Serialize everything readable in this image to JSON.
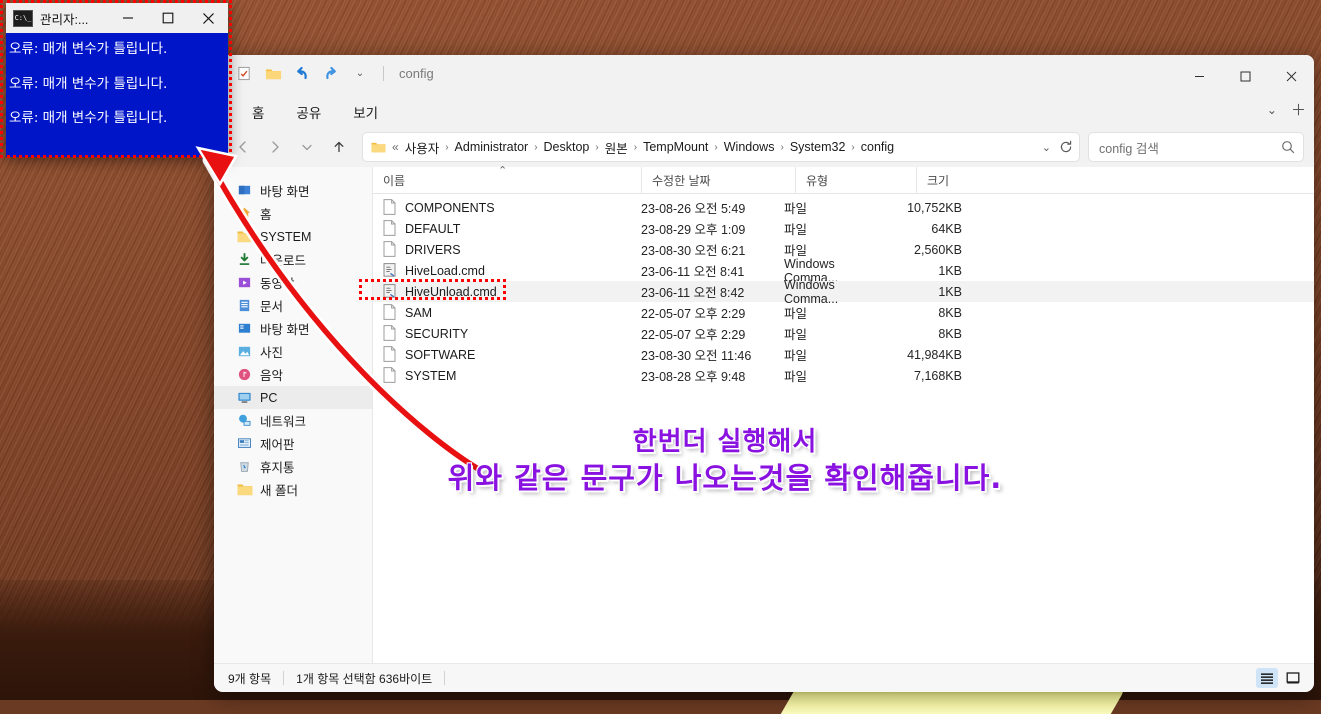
{
  "console_window": {
    "title": "관리자:...",
    "icon": "console-icon",
    "minimize": "—",
    "maximize": "□",
    "close": "✕",
    "lines": [
      "오류: 매개 변수가 틀립니다.",
      "오류: 매개 변수가 틀립니다.",
      "오류: 매개 변수가 틀립니다."
    ],
    "bg_color": "#0015c8",
    "text_color": "#ffffff"
  },
  "explorer": {
    "window_title": "config",
    "quick_access": [
      {
        "name": "properties-icon",
        "glyph": "☑"
      },
      {
        "name": "new-folder-icon",
        "glyph": "📁"
      },
      {
        "name": "undo-icon",
        "glyph": "↩"
      },
      {
        "name": "redo-icon",
        "glyph": "↪"
      },
      {
        "name": "customize-chevron-icon",
        "glyph": "⌄"
      }
    ],
    "window_controls": {
      "minimize": "—",
      "maximize": "□",
      "close": "✕"
    },
    "ribbon_tabs": [
      {
        "label": "홈"
      },
      {
        "label": "공유"
      },
      {
        "label": "보기"
      }
    ],
    "ribbon_right": [
      {
        "name": "ribbon-expand-icon",
        "glyph": "⌄"
      },
      {
        "name": "help-add-icon",
        "glyph": "＋"
      }
    ],
    "nav": {
      "back": "←",
      "forward": "→",
      "recent": "⌄",
      "up": "↑"
    },
    "breadcrumb": {
      "folder_icon": "folder-icon",
      "overflow": "«",
      "items": [
        "사용자",
        "Administrator",
        "Desktop",
        "원본",
        "TempMount",
        "Windows",
        "System32",
        "config"
      ],
      "separator": "›",
      "dropdown": "⌄",
      "refresh": "⟳"
    },
    "search": {
      "placeholder": "config 검색",
      "icon": "search-icon"
    },
    "sidebar": {
      "items": [
        {
          "label": "바탕 화면",
          "icon": "desktop-blue-icon",
          "selected": false
        },
        {
          "label": "홈",
          "icon": "home-icon",
          "selected": false
        },
        {
          "label": "SYSTEM",
          "icon": "folder-icon",
          "selected": false
        },
        {
          "label": "다운로드",
          "icon": "downloads-icon",
          "selected": false
        },
        {
          "label": "동영상",
          "icon": "videos-icon",
          "selected": false
        },
        {
          "label": "문서",
          "icon": "documents-icon",
          "selected": false
        },
        {
          "label": "바탕 화면",
          "icon": "desktop-icon",
          "selected": false
        },
        {
          "label": "사진",
          "icon": "pictures-icon",
          "selected": false
        },
        {
          "label": "음악",
          "icon": "music-icon",
          "selected": false
        },
        {
          "label": "PC",
          "icon": "pc-icon",
          "selected": true
        },
        {
          "label": "네트워크",
          "icon": "network-icon",
          "selected": false
        },
        {
          "label": "제어판",
          "icon": "control-panel-icon",
          "selected": false
        },
        {
          "label": "휴지통",
          "icon": "recycle-bin-icon",
          "selected": false
        },
        {
          "label": "새 폴더",
          "icon": "folder-icon",
          "selected": false
        }
      ]
    },
    "columns": [
      {
        "label": "이름",
        "key": "name"
      },
      {
        "label": "수정한 날짜",
        "key": "date"
      },
      {
        "label": "유형",
        "key": "type"
      },
      {
        "label": "크기",
        "key": "size"
      }
    ],
    "sort_indicator": "⌃",
    "files": [
      {
        "name": "COMPONENTS",
        "date": "23-08-26 오전 5:49",
        "type": "파일",
        "size": "10,752KB",
        "icon": "file-icon",
        "selected": false
      },
      {
        "name": "DEFAULT",
        "date": "23-08-29 오후 1:09",
        "type": "파일",
        "size": "64KB",
        "icon": "file-icon",
        "selected": false
      },
      {
        "name": "DRIVERS",
        "date": "23-08-30 오전 6:21",
        "type": "파일",
        "size": "2,560KB",
        "icon": "file-icon",
        "selected": false
      },
      {
        "name": "HiveLoad.cmd",
        "date": "23-06-11 오전 8:41",
        "type": "Windows Comma...",
        "size": "1KB",
        "icon": "script-icon",
        "selected": false
      },
      {
        "name": "HiveUnload.cmd",
        "date": "23-06-11 오전 8:42",
        "type": "Windows Comma...",
        "size": "1KB",
        "icon": "script-icon",
        "selected": true
      },
      {
        "name": "SAM",
        "date": "22-05-07 오후 2:29",
        "type": "파일",
        "size": "8KB",
        "icon": "file-icon",
        "selected": false
      },
      {
        "name": "SECURITY",
        "date": "22-05-07 오후 2:29",
        "type": "파일",
        "size": "8KB",
        "icon": "file-icon",
        "selected": false
      },
      {
        "name": "SOFTWARE",
        "date": "23-08-30 오전 11:46",
        "type": "파일",
        "size": "41,984KB",
        "icon": "file-icon",
        "selected": false
      },
      {
        "name": "SYSTEM",
        "date": "23-08-28 오후 9:48",
        "type": "파일",
        "size": "7,168KB",
        "icon": "file-icon",
        "selected": false
      }
    ],
    "status": {
      "item_count": "9개 항목",
      "selection": "1개 항목 선택함 636바이트"
    },
    "view_toggles": [
      {
        "name": "details-view",
        "glyph": "☰",
        "active": true
      },
      {
        "name": "large-icons-view",
        "glyph": "❐",
        "active": false
      }
    ]
  },
  "annotations": {
    "line1": "한번더  실행해서",
    "line2": "위와  같은  문구가  나오는것을  확인해줍니다.",
    "text_color": "#8a12e0",
    "box_color": "#ff0000",
    "arrow_color": "#e81010"
  }
}
